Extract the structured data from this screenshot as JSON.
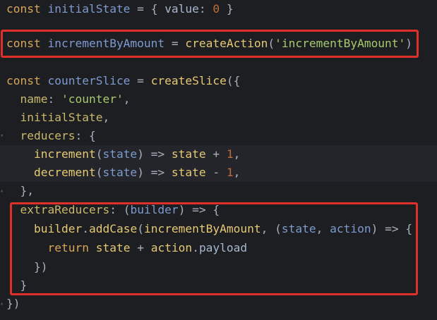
{
  "code": {
    "l1": {
      "kw": "const",
      "name": "initialState",
      "eq": " = ",
      "open": "{ ",
      "key": "value",
      "colon": ": ",
      "num": "0",
      "close": " }"
    },
    "l2": {
      "kw": "const",
      "name": "incrementByAmount",
      "eq": " = ",
      "fn": "createAction",
      "open": "(",
      "str": "'incrementByAmount'",
      "close": ")"
    },
    "l3": {
      "kw": "const",
      "name": "counterSlice",
      "eq": " = ",
      "fn": "createSlice",
      "open": "({"
    },
    "l4": {
      "key": "name",
      "colon": ": ",
      "str": "'counter'",
      "comma": ","
    },
    "l5": {
      "key": "initialState",
      "comma": ","
    },
    "l6": {
      "key": "reducers",
      "colon": ": ",
      "open": "{"
    },
    "l7": {
      "fn": "increment",
      "open": "(",
      "param": "state",
      "close": ")",
      "arrow": " => ",
      "body": "state",
      "op": " + ",
      "num": "1",
      "comma": ","
    },
    "l8": {
      "fn": "decrement",
      "open": "(",
      "param": "state",
      "close": ")",
      "arrow": " => ",
      "body": "state",
      "op": " - ",
      "num": "1",
      "comma": ","
    },
    "l9": {
      "close": "},"
    },
    "l10": {
      "key": "extraReducers",
      "colon": ": ",
      "open": "(",
      "param": "builder",
      "close": ")",
      "arrow": " => ",
      "brace": "{"
    },
    "l11": {
      "obj": "builder",
      "dot": ".",
      "fn": "addCase",
      "open": "(",
      "arg": "incrementByAmount",
      "sep": ", ",
      "open2": "(",
      "p1": "state",
      "sep2": ", ",
      "p2": "action",
      "close2": ")",
      "arrow": " => ",
      "brace": "{"
    },
    "l12": {
      "kw": "return",
      "body": "state",
      "op": " + ",
      "obj": "action",
      "dot": ".",
      "prop": "payload"
    },
    "l13": {
      "close": "})"
    },
    "l14": {
      "close": "}"
    },
    "l15": {
      "close": "})"
    }
  },
  "highlight_color": "#e0302a"
}
